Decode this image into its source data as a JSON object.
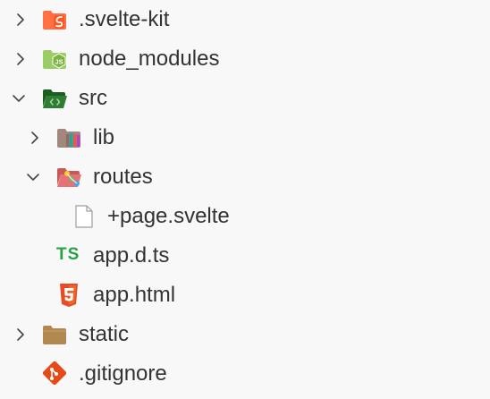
{
  "explorer": {
    "items": [
      {
        "label": ".svelte-kit",
        "icon": "svelte-folder-icon",
        "chevron": "chevron-right-icon",
        "expanded": false
      },
      {
        "label": "node_modules",
        "icon": "node-folder-icon",
        "chevron": "chevron-right-icon",
        "expanded": false
      },
      {
        "label": "src",
        "icon": "src-folder-open-icon",
        "chevron": "chevron-down-icon",
        "expanded": true
      },
      {
        "label": "lib",
        "icon": "lib-folder-icon",
        "chevron": "chevron-right-icon",
        "expanded": false
      },
      {
        "label": "routes",
        "icon": "routes-folder-open-icon",
        "chevron": "chevron-down-icon",
        "expanded": true
      },
      {
        "label": "+page.svelte",
        "icon": "blank-file-icon"
      },
      {
        "label": "app.d.ts",
        "icon": "typescript-file-icon",
        "badge": "TS"
      },
      {
        "label": "app.html",
        "icon": "html5-file-icon"
      },
      {
        "label": "static",
        "icon": "static-folder-icon",
        "chevron": "chevron-right-icon",
        "expanded": false
      },
      {
        "label": ".gitignore",
        "icon": "git-file-icon"
      }
    ]
  },
  "colors": {
    "background": "#f8f8f8",
    "text": "#333333",
    "chevron": "#444444",
    "svelte": "#ff5722",
    "node": "#8bc34a",
    "src_folder": "#2e7d32",
    "lib_folder": "#a1887f",
    "routes_folder": "#e57373",
    "typescript": "#27a243",
    "html5": "#e44d26",
    "static_folder": "#b08850",
    "git": "#e64a19"
  }
}
